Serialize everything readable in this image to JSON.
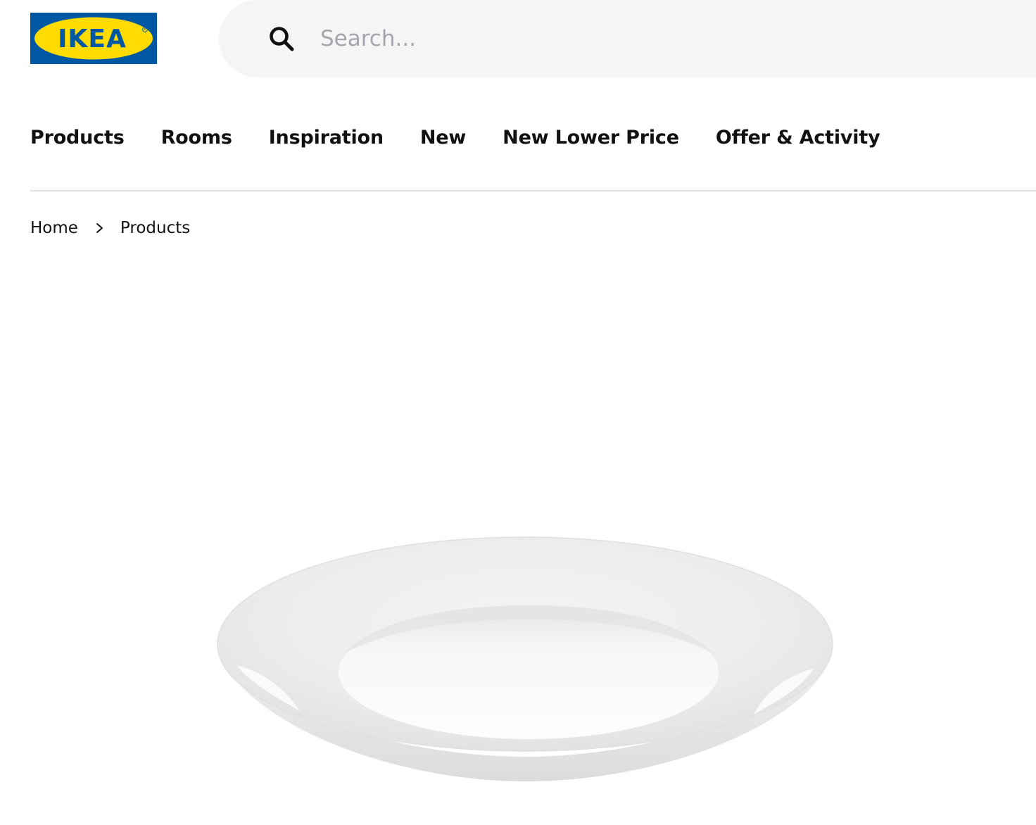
{
  "header": {
    "logo_text": "IKEA",
    "brand_colors": {
      "blue": "#0058a3",
      "yellow": "#ffdb00"
    }
  },
  "search": {
    "placeholder": "Search..."
  },
  "nav": {
    "items": [
      {
        "label": "Products"
      },
      {
        "label": "Rooms"
      },
      {
        "label": "Inspiration"
      },
      {
        "label": "New"
      },
      {
        "label": "New Lower Price"
      },
      {
        "label": "Offer & Activity"
      }
    ]
  },
  "breadcrumb": {
    "items": [
      {
        "label": "Home"
      },
      {
        "label": "Products"
      }
    ],
    "separator_icon": "chevron-right-icon"
  },
  "product": {
    "image_subject": "white-plate"
  }
}
